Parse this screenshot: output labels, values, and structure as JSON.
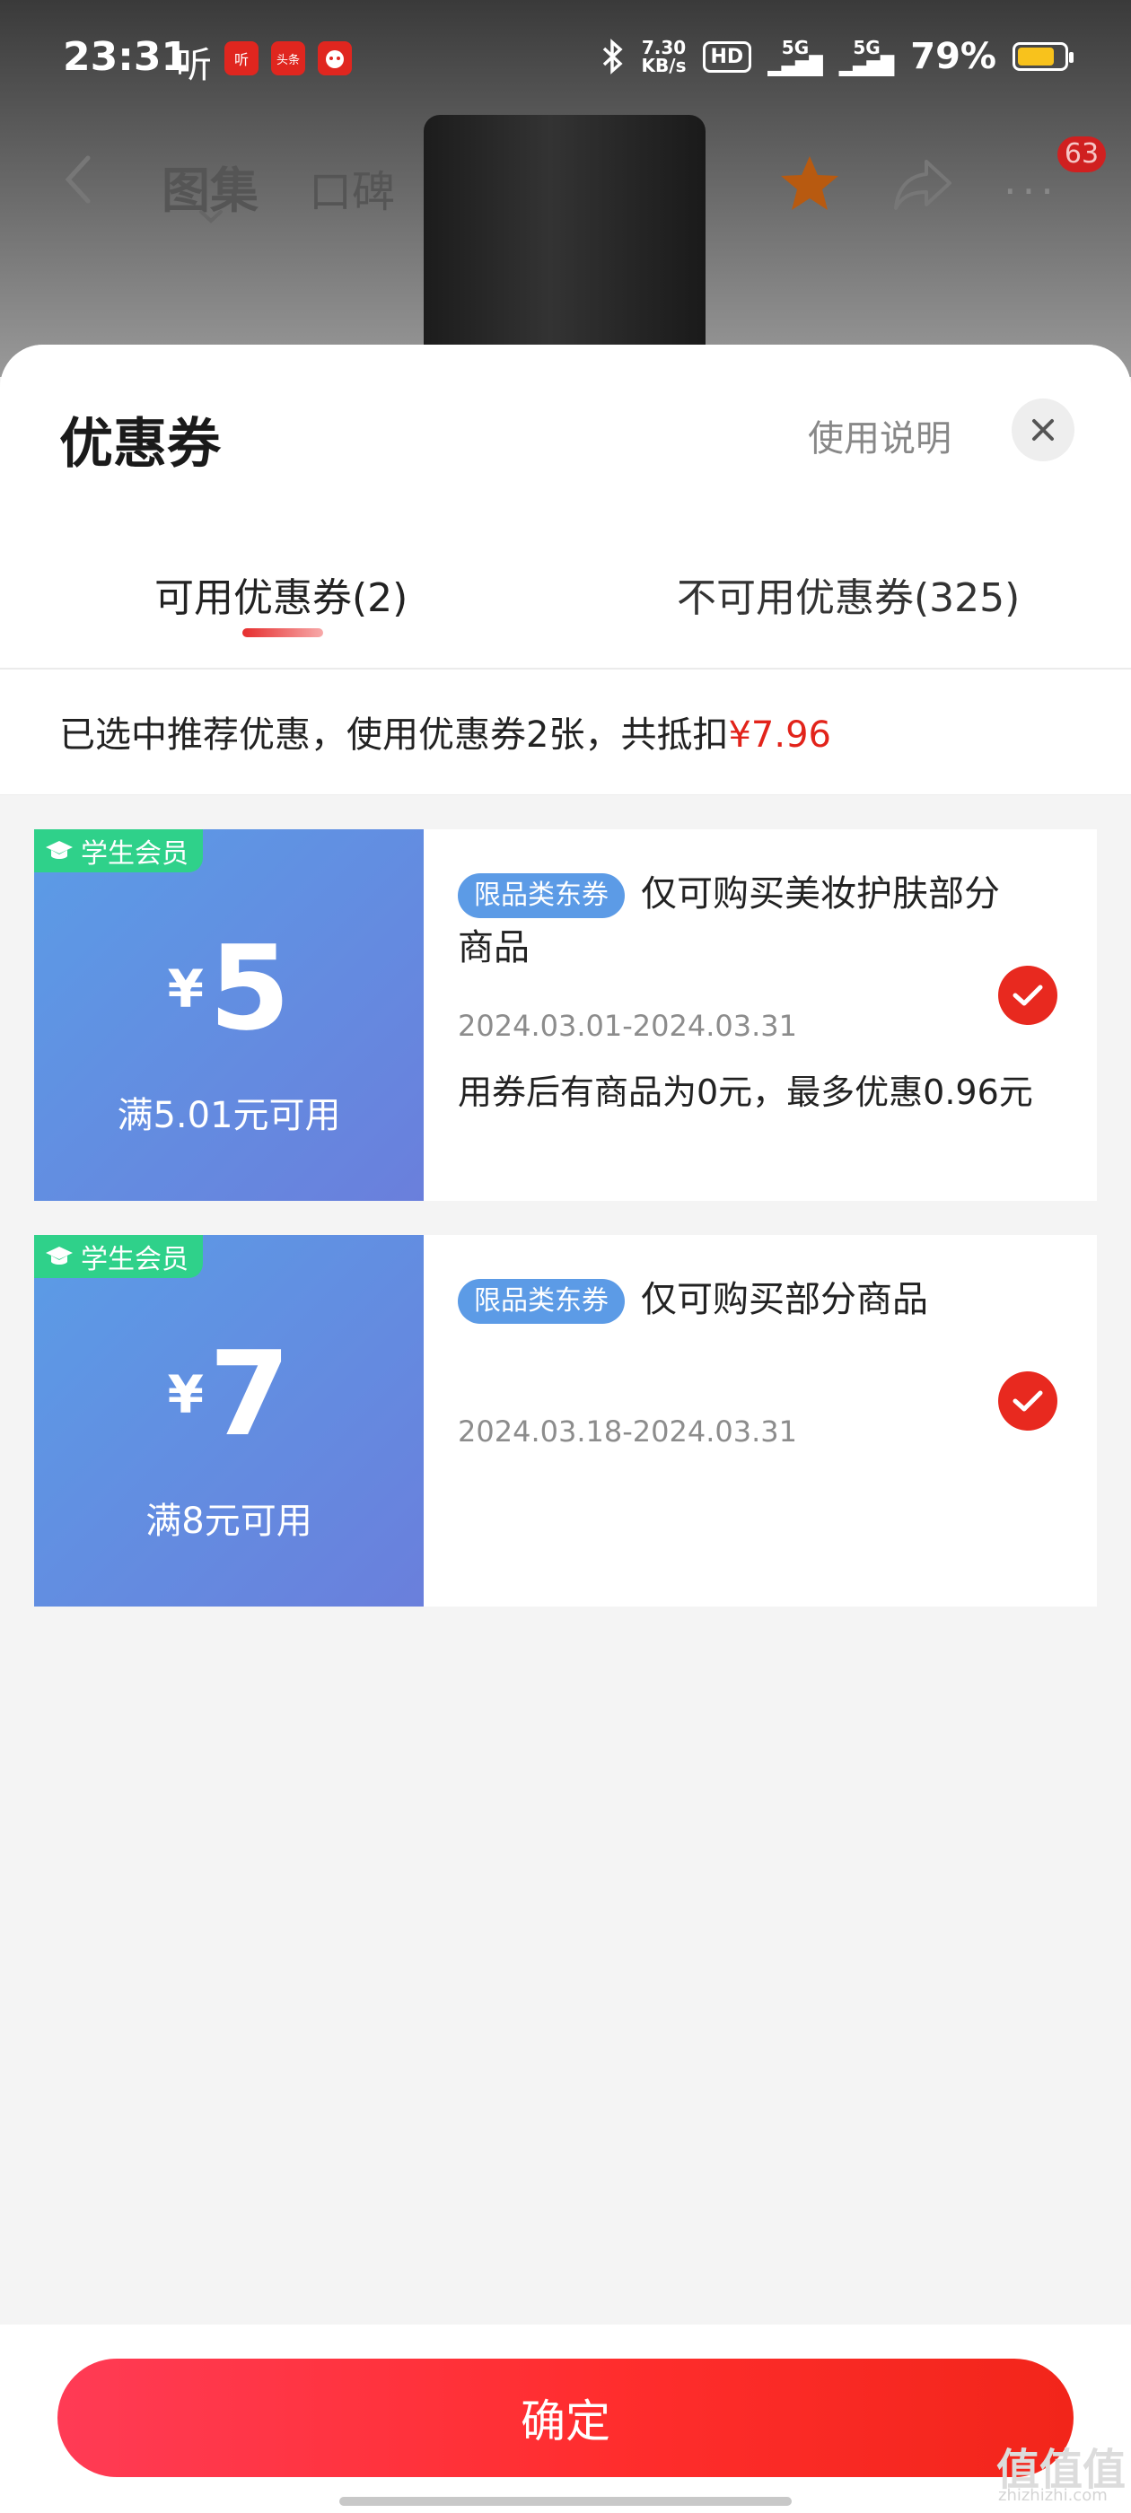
{
  "status_bar": {
    "time": "23:31",
    "listen_label": "听",
    "app_icons": [
      "听",
      "头条",
      ""
    ],
    "network_speed_top": "7.30",
    "network_speed_bottom": "KB/s",
    "hd_label": "HD",
    "signal_1": "5G",
    "signal_2": "5G",
    "battery_percent": "79%",
    "battery_level": 0.79,
    "battery_color": "#f8c21c"
  },
  "nav": {
    "tab_gallery": "图集",
    "tab_reviews": "口碑",
    "more_label": "···",
    "badge_count": "63"
  },
  "sheet": {
    "title": "优惠券",
    "help_label": "使用说明",
    "tabs": [
      {
        "label": "可用优惠券(2)",
        "active": true
      },
      {
        "label": "不可用优惠券(325)",
        "active": false
      }
    ],
    "summary_prefix": "已选中推荐优惠，使用优惠券2张，共抵扣",
    "summary_amount": "¥7.96",
    "accent_color": "#e2231a"
  },
  "coupons": [
    {
      "tag": "学生会员",
      "currency": "¥",
      "amount": "5",
      "condition": "满5.01元可用",
      "category_chip": "限品类东券",
      "description": "仅可购买美妆护肤部分商品",
      "date_range": "2024.03.01-2024.03.31",
      "note": "用券后有商品为0元，最多优惠0.96元",
      "selected": true
    },
    {
      "tag": "学生会员",
      "currency": "¥",
      "amount": "7",
      "condition": "满8元可用",
      "category_chip": "限品类东券",
      "description": "仅可购买部分商品",
      "date_range": "2024.03.18-2024.03.31",
      "note": "",
      "selected": true
    }
  ],
  "footer": {
    "confirm_label": "确定"
  },
  "watermark": {
    "main": "值值值",
    "sub": "zhizhizhi.com"
  }
}
